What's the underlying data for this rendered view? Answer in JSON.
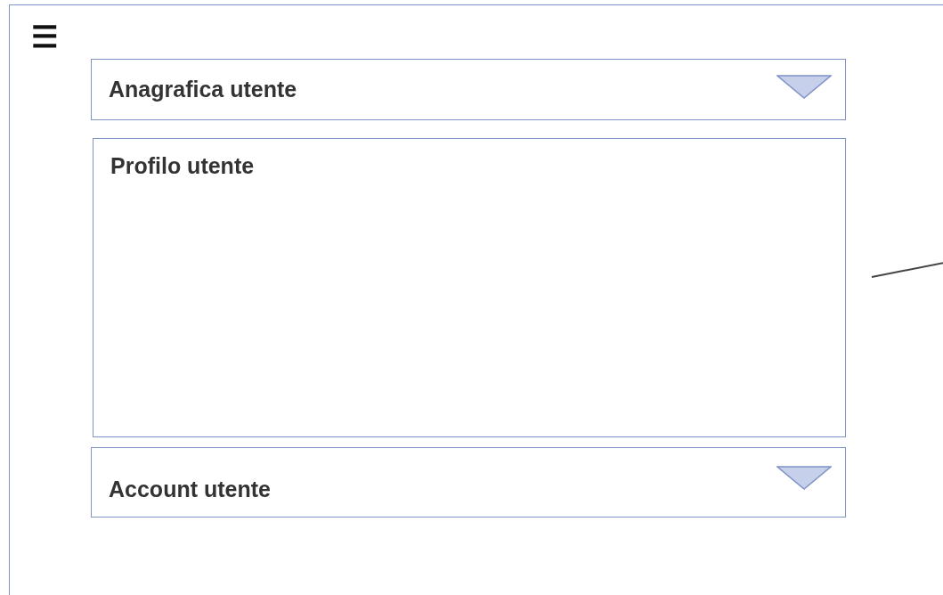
{
  "menu_button": {
    "label": "☰"
  },
  "sections": [
    {
      "kind": "dropdown",
      "title": "Anagrafica utente"
    },
    {
      "kind": "panel",
      "title": "Profilo utente"
    },
    {
      "kind": "dropdown",
      "title": "Account utente"
    }
  ]
}
